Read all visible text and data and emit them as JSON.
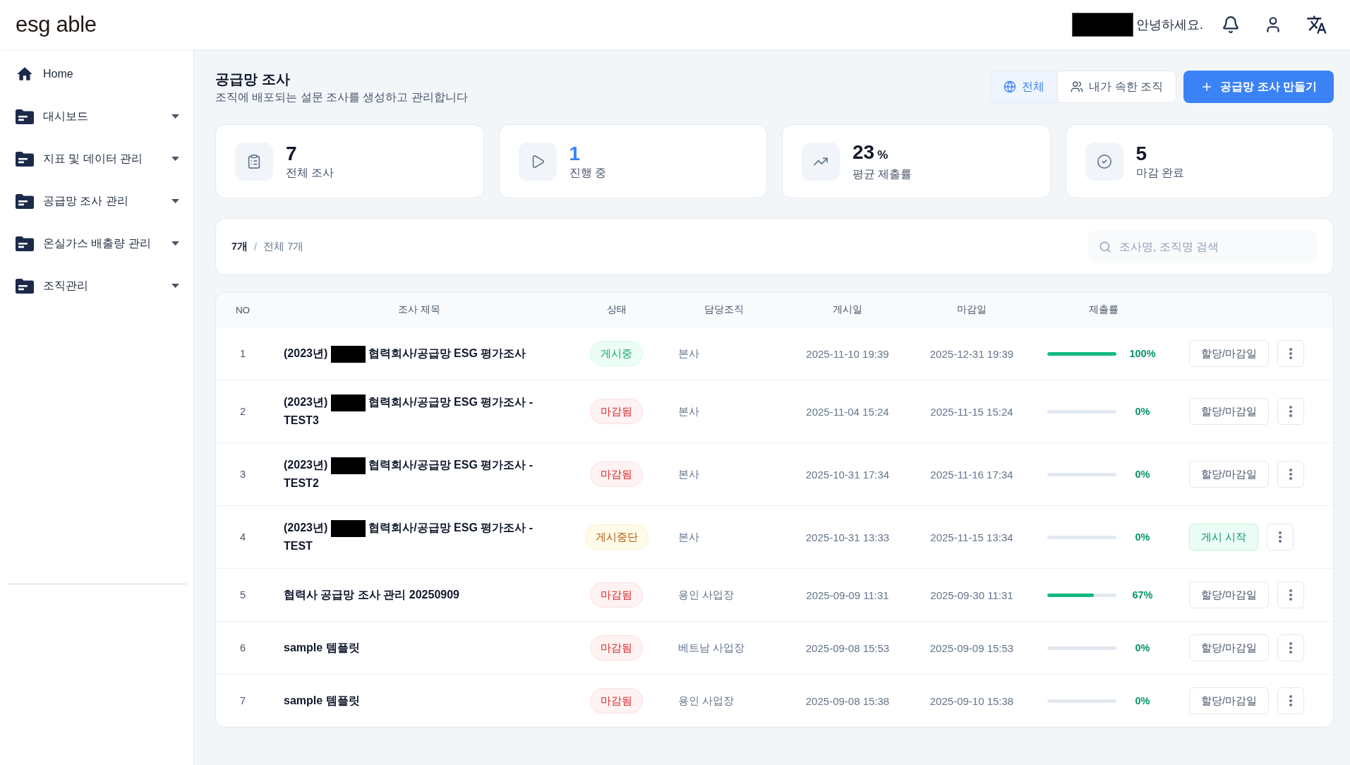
{
  "header": {
    "logo": "esg able",
    "user_redacted": true,
    "greeting": "안녕하세요."
  },
  "sidebar": {
    "items": [
      {
        "label": "Home",
        "kind": "link"
      },
      {
        "label": "대시보드",
        "kind": "menu",
        "expanded": false
      },
      {
        "label": "지표 및 데이터 관리",
        "kind": "menu",
        "expanded": false
      },
      {
        "label": "공급망 조사 관리",
        "kind": "menu",
        "expanded": false
      },
      {
        "label": "온실가스 배출량 관리",
        "kind": "menu",
        "expanded": false
      },
      {
        "label": "조직관리",
        "kind": "menu",
        "expanded": false
      }
    ]
  },
  "page": {
    "title": "공급망 조사",
    "subtitle": "조직에 배포되는 설문 조사를 생성하고 관리합니다"
  },
  "scope_tabs": [
    {
      "label": "전체",
      "selected": true
    },
    {
      "label": "내가 속한 조직",
      "selected": false
    }
  ],
  "create_button": "공급망 조사 만들기",
  "stats": [
    {
      "kind": "total",
      "value": "7",
      "label": "전체 조사",
      "highlighted": false
    },
    {
      "kind": "in_progress",
      "value": "1",
      "label": "진행 중",
      "highlighted": true
    },
    {
      "kind": "rate",
      "value": "23",
      "unit": "%",
      "label": "평균 제출률",
      "highlighted": false
    },
    {
      "kind": "closed",
      "value": "5",
      "label": "마감 완료",
      "highlighted": false
    }
  ],
  "filter": {
    "shown_count": "7개",
    "separator": "/",
    "total_count": "전체 7개",
    "search": {
      "placeholder": "조사명, 조직명 검색"
    }
  },
  "table": {
    "columns": [
      "NO",
      "조사 제목",
      "상태",
      "담당조직",
      "게시일",
      "마감일",
      "제출률"
    ],
    "rows": [
      {
        "no": "1",
        "prefix": "(2023년)",
        "redacted": true,
        "title": "협력회사/공급망 ESG 평가조사",
        "status": {
          "label": "게시중",
          "kind": "active"
        },
        "org": "본사",
        "posted": "2025-11-10 19:39",
        "deadline": "2025-12-31 19:39",
        "rate": {
          "level": 1,
          "reading": "100%"
        },
        "action": {
          "label": "할당/마감일",
          "kind": "assign"
        }
      },
      {
        "no": "2",
        "prefix": "(2023년)",
        "redacted": true,
        "title": "협력회사/공급망 ESG 평가조사 - TEST3",
        "status": {
          "label": "마감됨",
          "kind": "closed"
        },
        "org": "본사",
        "posted": "2025-11-04 15:24",
        "deadline": "2025-11-15 15:24",
        "rate": {
          "level": 0,
          "reading": "0%"
        },
        "action": {
          "label": "할당/마감일",
          "kind": "assign"
        }
      },
      {
        "no": "3",
        "prefix": "(2023년)",
        "redacted": true,
        "title": "협력회사/공급망 ESG 평가조사 - TEST2",
        "status": {
          "label": "마감됨",
          "kind": "closed"
        },
        "org": "본사",
        "posted": "2025-10-31 17:34",
        "deadline": "2025-11-16 17:34",
        "rate": {
          "level": 0,
          "reading": "0%"
        },
        "action": {
          "label": "할당/마감일",
          "kind": "assign"
        }
      },
      {
        "no": "4",
        "prefix": "(2023년)",
        "redacted": true,
        "title": "협력회사/공급망 ESG 평가조사 - TEST",
        "status": {
          "label": "게시중단",
          "kind": "paused"
        },
        "org": "본사",
        "posted": "2025-10-31 13:33",
        "deadline": "2025-11-15 13:34",
        "rate": {
          "level": 0,
          "reading": "0%"
        },
        "action": {
          "label": "게시 시작",
          "kind": "publish"
        }
      },
      {
        "no": "5",
        "redacted": false,
        "title": "협력사 공급망 조사 관리 20250909",
        "status": {
          "label": "마감됨",
          "kind": "closed"
        },
        "org": "용인 사업장",
        "posted": "2025-09-09 11:31",
        "deadline": "2025-09-30 11:31",
        "rate": {
          "level": 0.67,
          "reading": "67%"
        },
        "action": {
          "label": "할당/마감일",
          "kind": "assign"
        }
      },
      {
        "no": "6",
        "redacted": false,
        "title": "sample 템플릿",
        "status": {
          "label": "마감됨",
          "kind": "closed"
        },
        "org": "베트남 사업장",
        "posted": "2025-09-08 15:53",
        "deadline": "2025-09-09 15:53",
        "rate": {
          "level": 0,
          "reading": "0%"
        },
        "action": {
          "label": "할당/마감일",
          "kind": "assign"
        }
      },
      {
        "no": "7",
        "redacted": false,
        "title": "sample 템플릿",
        "status": {
          "label": "마감됨",
          "kind": "closed"
        },
        "org": "용인 사업장",
        "posted": "2025-09-08 15:38",
        "deadline": "2025-09-10 15:38",
        "rate": {
          "level": 0,
          "reading": "0%"
        },
        "action": {
          "label": "할당/마감일",
          "kind": "assign"
        }
      }
    ]
  }
}
